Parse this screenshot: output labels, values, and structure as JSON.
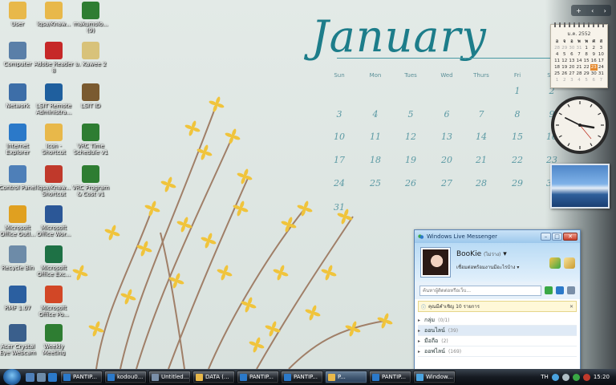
{
  "desktop_icons": [
    {
      "name": "user-folder-icon",
      "label": "User",
      "color": "#e8b84a"
    },
    {
      "name": "lqsa-folder-icon",
      "label": "lqsa/Knaw...",
      "color": "#e8b84a"
    },
    {
      "name": "excel-file-icon",
      "label": "makumolo... (9)",
      "color": "#2e7d32"
    },
    {
      "name": "computer-icon",
      "label": "Computer",
      "color": "#5a7fa8"
    },
    {
      "name": "adobe-reader-icon",
      "label": "Adobe Reader 8",
      "color": "#c62828"
    },
    {
      "name": "kawee-file-icon",
      "label": "ม. Kawee 2",
      "color": "#d8c27a"
    },
    {
      "name": "network-icon",
      "label": "Network",
      "color": "#3d6ea8"
    },
    {
      "name": "remote-desktop-icon",
      "label": "LSIT Remote Administra...",
      "color": "#1f5f9e"
    },
    {
      "name": "lsit-icon",
      "label": "LSIT ID",
      "color": "#7a5a30"
    },
    {
      "name": "internet-explorer-icon",
      "label": "Internet Explorer",
      "color": "#2b79c9"
    },
    {
      "name": "icon-shortcut-icon",
      "label": "Icon - Shortcut",
      "color": "#e8b84a"
    },
    {
      "name": "vrc-time-schedule-icon",
      "label": "VRC Time Schedule v1",
      "color": "#2e7d32"
    },
    {
      "name": "control-panel-icon",
      "label": "Control Panel",
      "color": "#4e7fb8"
    },
    {
      "name": "lqsa-shortcut-icon",
      "label": "lqsa/Knaw... Shortcut",
      "color": "#c0392b"
    },
    {
      "name": "vrc-program-icon",
      "label": "VRC Program & Cost v1",
      "color": "#2e7d32"
    },
    {
      "name": "office-outlook-icon",
      "label": "Microsoft Office Outl...",
      "color": "#e0a020"
    },
    {
      "name": "office-word-icon",
      "label": "Microsoft Office Wor...",
      "color": "#2b5797"
    },
    {
      "name": "recycle-bin-icon",
      "label": "Recycle Bin",
      "color": "#6d8ba8"
    },
    {
      "name": "office-excel-icon",
      "label": "Microsoft Office Exc...",
      "color": "#1e7145"
    },
    {
      "name": "rmf-icon",
      "label": "RMF 1.07",
      "color": "#2b5fa0"
    },
    {
      "name": "office-powerpoint-icon",
      "label": "Microsoft Office Po...",
      "color": "#d24726"
    },
    {
      "name": "webcam-icon",
      "label": "Acer Crystal Eye Webcam",
      "color": "#3a5f8c"
    },
    {
      "name": "weekly-meeting-icon",
      "label": "Weekly Meeting",
      "color": "#2e7d32"
    }
  ],
  "wallpaper_calendar": {
    "month": "January",
    "weekdays": [
      "Sun",
      "Mon",
      "Tues",
      "Wed",
      "Thurs",
      "Fri",
      "Sat"
    ],
    "days": [
      "1",
      "2",
      "3",
      "4",
      "5",
      "6",
      "7",
      "8",
      "9",
      "10",
      "11",
      "12",
      "13",
      "14",
      "15",
      "16",
      "17",
      "18",
      "19",
      "20",
      "21",
      "22",
      "23",
      "24",
      "25",
      "26",
      "27",
      "28",
      "29",
      "30",
      "31"
    ]
  },
  "sidebar": {
    "top_controls": [
      "+",
      "‹",
      "›"
    ],
    "calendar_gadget": {
      "header": "ม.ค. 2552",
      "weekdays": [
        "อ",
        "จ",
        "อ",
        "พ",
        "พ",
        "ศ",
        "ส"
      ],
      "days": [
        "28",
        "29",
        "30",
        "31",
        "1",
        "2",
        "3",
        "4",
        "5",
        "6",
        "7",
        "8",
        "9",
        "10",
        "11",
        "12",
        "13",
        "14",
        "15",
        "16",
        "17",
        "18",
        "19",
        "20",
        "21",
        "22",
        "23",
        "24",
        "25",
        "26",
        "27",
        "28",
        "29",
        "30",
        "31",
        "1",
        "2",
        "3",
        "4",
        "5",
        "6",
        "7"
      ],
      "today": "23"
    }
  },
  "messenger": {
    "title": "Windows Live Messenger",
    "controls": [
      "–",
      "□",
      "✕"
    ],
    "display_name": "BooKie",
    "display_status": "(ไม่ว่าง)",
    "personal_message": "เชื่อมต่อพร้อมงานมีอะไรบ้าง",
    "search_placeholder": "ค้นหาผู้ติดต่อหรือเว็บ...",
    "notice": "คุณมีคำเชิญ 10 รายการ",
    "groups": [
      {
        "label": "กลุ่ม",
        "count": "(0/1)"
      },
      {
        "label": "ออนไลน์",
        "count": "(39)"
      },
      {
        "label": "มือถือ",
        "count": "(2)"
      },
      {
        "label": "ออฟไลน์",
        "count": "(169)"
      }
    ]
  },
  "taskbar": {
    "buttons": [
      {
        "label": "PANTIP...",
        "color": "#2b79c9"
      },
      {
        "label": "kodou0...",
        "color": "#2b79c9"
      },
      {
        "label": "Untitled...",
        "color": "#7a8fa8"
      },
      {
        "label": "DATA (...",
        "color": "#e8b84a"
      },
      {
        "label": "PANTIP...",
        "color": "#2b79c9"
      },
      {
        "label": "PANTIP...",
        "color": "#2b79c9"
      },
      {
        "label": "P...",
        "color": "#e8b84a"
      },
      {
        "label": "PANTIP...",
        "color": "#2b79c9"
      },
      {
        "label": "Window...",
        "color": "#4aa3df"
      }
    ],
    "language": "TH",
    "time": "15:20"
  }
}
